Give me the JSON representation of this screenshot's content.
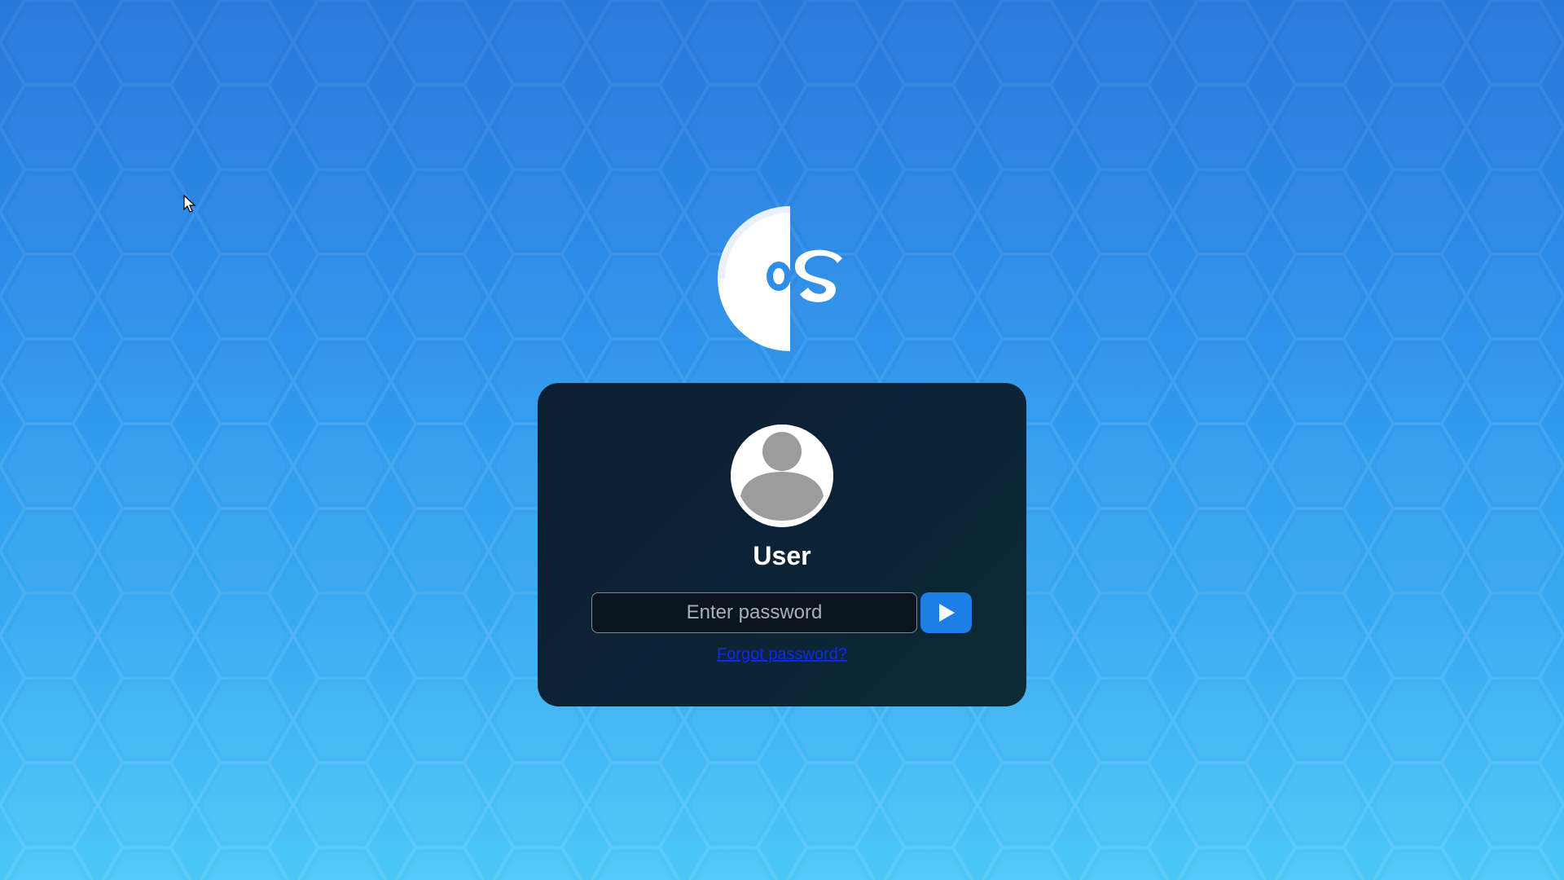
{
  "wallpaper": {
    "description_icon": "hexagon-pattern",
    "colors": {
      "top": "#2f86e8",
      "bottom": "#3cc3f7"
    }
  },
  "logo": {
    "letters": "os",
    "color": "#ffffff"
  },
  "login": {
    "user_name": "User",
    "password_placeholder": "Enter password",
    "password_value": "",
    "submit_icon": "play-arrow-icon",
    "forgot_password_label": "Forgot password?",
    "colors": {
      "card_bg": "#0c2336",
      "submit_bg": "#1c7fe8",
      "link": "#0b2bf0"
    }
  }
}
